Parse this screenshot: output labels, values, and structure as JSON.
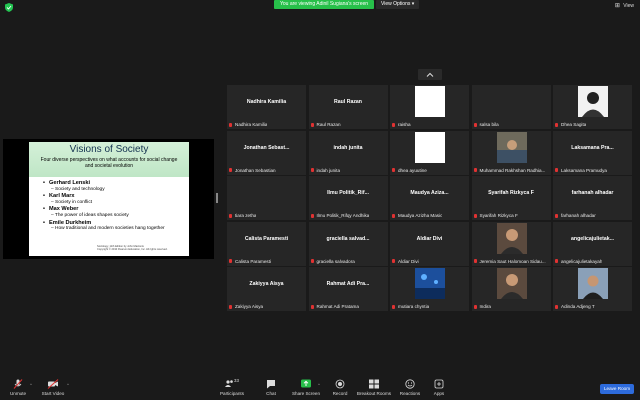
{
  "topbar": {
    "share_notice": "You are viewing Adinil Sugiana's screen",
    "view_options": "View Options",
    "view_button": "View",
    "view_options_caret": "▾",
    "view_icon": "grid-view-icon",
    "security_icon": "shield-icon",
    "shield_color": "#23c552"
  },
  "slide": {
    "title": "Visions of Society",
    "subtitle": "Four diverse perspectives on what accounts for social change and societal evolution",
    "items": [
      {
        "name": "Gerhard Lenski",
        "detail": "Society and technology"
      },
      {
        "name": "Karl Marx",
        "detail": "Society in conflict"
      },
      {
        "name": "Max Weber",
        "detail": "The power of ideas shapes society"
      },
      {
        "name": "Emile Durkheim",
        "detail": "How traditional and modern societies hang together"
      }
    ],
    "footnote_1": "Sociology, 11th Edition by John Macionis",
    "footnote_2": "Copyright © 2010 Pearson Education, Inc. All rights reserved."
  },
  "gallery": {
    "collapse_icon": "chevron-up-icon",
    "tiles": [
      {
        "center": "Nadhira Kamilia",
        "label": "Nadhira Kamilia"
      },
      {
        "center": "Raul Razan",
        "label": "Raul Razan"
      },
      {
        "image": "white",
        "label": "raisha"
      },
      {
        "center": "",
        "label": "salsa bila"
      },
      {
        "image": "person-dark",
        "label": "Dhea Sagita"
      },
      {
        "center": "Jonathan Sebast...",
        "label": "Jonathan Sebastian"
      },
      {
        "center": "indah junita",
        "label": "indah junita"
      },
      {
        "image": "white",
        "label": "dhea ayuutine"
      },
      {
        "image": "photo",
        "label": "Muhammad Rakhshan Radhia..."
      },
      {
        "center": "Laksamana Pra...",
        "label": "Laksamana Pramudya"
      },
      {
        "center": "",
        "label": "tiara zetha"
      },
      {
        "center": "Ilmu Politik_Rif...",
        "label": "Ilmu Politik_Rifqy Andhika"
      },
      {
        "center": "Maudya Aziza...",
        "label": "Maudya Azizha Masic"
      },
      {
        "center": "Syarifah Rizkyca F",
        "label": "Syarifah Rizkyca F"
      },
      {
        "center": "farhanah alhadar",
        "label": "farhanah alhadar"
      },
      {
        "center": "Calista Paramesti",
        "label": "Calista Paramesti"
      },
      {
        "center": "graciella salvad...",
        "label": "graciella salvadora"
      },
      {
        "center": "Aldiar Divi",
        "label": "Aldiar Divi"
      },
      {
        "image": "person",
        "label": "Jeremia Saut Halomoan Sidau..."
      },
      {
        "center": "angelicajulietak...",
        "label": "angelicajulietakayah"
      },
      {
        "center": "Zakiyya Aisya",
        "label": "Zakiyya Aisya"
      },
      {
        "center": "Rahmat Adi Pra...",
        "label": "Rahmat Adi Pratama"
      },
      {
        "image": "aquarium",
        "label": "mutiara chyntia"
      },
      {
        "image": "person",
        "label": "Indira"
      },
      {
        "image": "person-outdoor",
        "label": "Adinda Adjeng T"
      }
    ]
  },
  "toolbar": {
    "unmute": "Unmute",
    "start_video": "Start Video",
    "participants": "Participants",
    "participants_count": "33",
    "chat": "Chat",
    "share_screen": "Share Screen",
    "record": "Record",
    "breakout_rooms": "Breakout Rooms",
    "reactions": "Reactions",
    "apps": "Apps",
    "leave": "Leave Room",
    "caret": "^"
  }
}
